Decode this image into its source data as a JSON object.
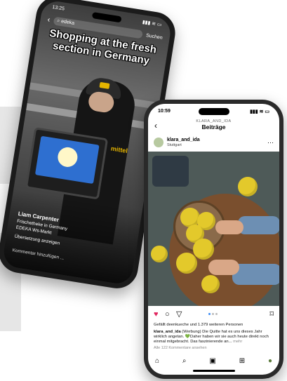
{
  "back_phone": {
    "time": "13:25",
    "status_icons": "▮▮▮ ≋ ▭",
    "search_query": "edeka",
    "search_action": "Suchen",
    "video_title": "Shopping at the fresh section in Germany",
    "store_sign": "mittel",
    "creator_name": "Liam Carpenter",
    "subtitle_line1": "Frischetheke in Germany",
    "subtitle_line2": "EDEKA Ws-Markt",
    "subtitle_line3": "Übersetzung anzeigen",
    "comment_placeholder": "Kommentar hinzufügen ..."
  },
  "front_phone": {
    "time": "10:59",
    "status_icons": "▮▮▮ ≋ ▭",
    "header_account": "KLARA_AND_IDA",
    "header_title": "Beiträge",
    "author": "klara_and_ida",
    "location": "Stuttgart",
    "likes_text": "Gefällt deenkueche und 1.379 weiteren Personen",
    "caption_user": "klara_and_ida",
    "caption_text": "(Werbung) Die Quitte hat es uns dieses Jahr wirklich angetan. 💚Daher haben wir sie auch heute direkt noch einmal mitgebracht. Das faszinierende an...",
    "caption_more": "mehr",
    "comments_link": "Alle 122 Kommentare ansehen"
  },
  "colors": {
    "like_red": "#e0245e",
    "carousel_active": "#3b8cf5",
    "quince_yellow": "#e3c92b"
  },
  "icons": {
    "back": "‹",
    "more": "⋯",
    "heart": "♥",
    "comment": "○",
    "share": "▽",
    "bookmark": "⌑",
    "home": "⌂",
    "search": "⌕",
    "reels": "▣",
    "shop": "⊞",
    "profile": "●"
  }
}
